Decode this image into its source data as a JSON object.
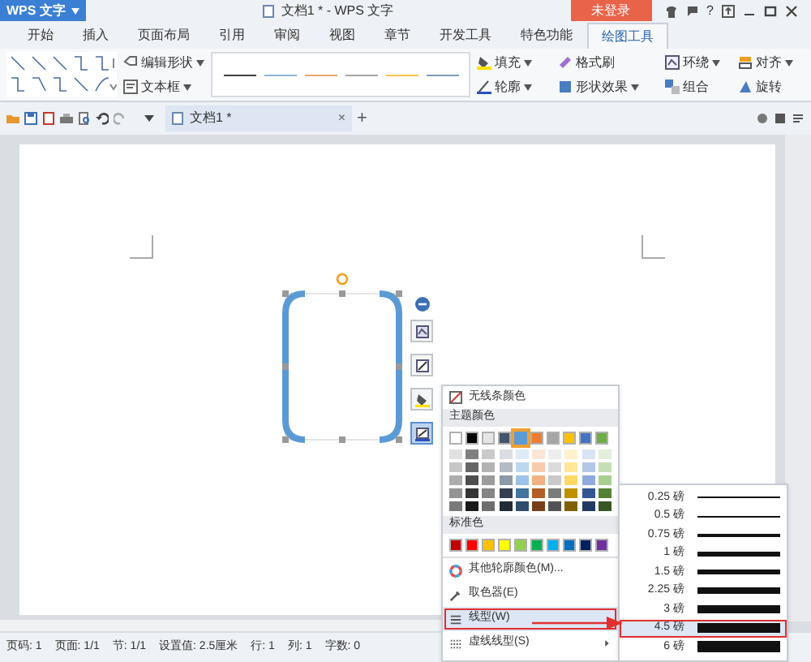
{
  "app_button": {
    "label": "WPS 文字"
  },
  "window": {
    "title": "文档1 * - WPS 文字"
  },
  "login_button": {
    "label": "未登录"
  },
  "help": {
    "label": "?"
  },
  "tabs": [
    {
      "label": "开始",
      "selected": false
    },
    {
      "label": "插入",
      "selected": false
    },
    {
      "label": "页面布局",
      "selected": false
    },
    {
      "label": "引用",
      "selected": false
    },
    {
      "label": "审阅",
      "selected": false
    },
    {
      "label": "视图",
      "selected": false
    },
    {
      "label": "章节",
      "selected": false
    },
    {
      "label": "开发工具",
      "selected": false
    },
    {
      "label": "特色功能",
      "selected": false
    },
    {
      "label": "绘图工具",
      "selected": true
    }
  ],
  "ribbon": {
    "shape_buttons": [
      {
        "label": "编辑形状"
      },
      {
        "label": "文本框"
      }
    ],
    "line_styles": [
      {
        "color": "#404040"
      },
      {
        "color": "#8fb4d9"
      },
      {
        "color": "#e8a86a"
      },
      {
        "color": "#a6a6a6"
      },
      {
        "color": "#f2c44a"
      },
      {
        "color": "#7f9bb8"
      }
    ],
    "format_buttons": [
      {
        "label": "填充",
        "dropdown": true
      },
      {
        "label": "格式刷",
        "dropdown": false
      },
      {
        "label": "轮廓",
        "dropdown": true
      },
      {
        "label": "形状效果",
        "dropdown": true
      }
    ],
    "arrange_buttons": [
      {
        "label": "环绕",
        "dropdown": true
      },
      {
        "label": "对齐",
        "dropdown": true
      },
      {
        "label": "组合",
        "dropdown": false
      },
      {
        "label": "旋转",
        "dropdown": false
      }
    ]
  },
  "doc_tab": {
    "title": "文档1 *",
    "close": "×"
  },
  "new_tab": {
    "label": "+"
  },
  "side_toolbar": [
    {
      "kind": "layout",
      "selected": false
    },
    {
      "kind": "edit",
      "selected": false
    },
    {
      "kind": "fill",
      "selected": false
    },
    {
      "kind": "outline",
      "selected": true
    }
  ],
  "color_menu": {
    "no_line": "无线条颜色",
    "theme_header": "主题颜色",
    "theme_colors": [
      {
        "color": "#ffffff",
        "selected": false
      },
      {
        "color": "#000000",
        "selected": false
      },
      {
        "color": "#e7e6e6",
        "selected": false
      },
      {
        "color": "#44546a",
        "selected": false
      },
      {
        "color": "#5b9bd5",
        "selected": true
      },
      {
        "color": "#ed7d31",
        "selected": false
      },
      {
        "color": "#a5a5a5",
        "selected": false
      },
      {
        "color": "#ffc000",
        "selected": false
      },
      {
        "color": "#4472c4",
        "selected": false
      },
      {
        "color": "#70ad47",
        "selected": false
      }
    ],
    "standard_header": "标准色",
    "standard_colors": [
      {
        "color": "#c00000"
      },
      {
        "color": "#ff0000"
      },
      {
        "color": "#ffc000"
      },
      {
        "color": "#ffff00"
      },
      {
        "color": "#92d050"
      },
      {
        "color": "#00b050"
      },
      {
        "color": "#00b0f0"
      },
      {
        "color": "#0070c0"
      },
      {
        "color": "#002060"
      },
      {
        "color": "#7030a0"
      }
    ],
    "items": [
      {
        "kind": "more-colors",
        "label": "其他轮廓颜色(M)...",
        "selected": false,
        "submenu_arrow": false
      },
      {
        "kind": "eyedropper",
        "label": "取色器(E)",
        "selected": false,
        "submenu_arrow": false
      },
      {
        "kind": "line-style",
        "label": "线型(W)",
        "selected": true,
        "submenu_arrow": false
      },
      {
        "kind": "dash-style",
        "label": "虚线线型(S)",
        "selected": false,
        "submenu_arrow": true
      }
    ]
  },
  "line_weights": [
    {
      "label": "0.25 磅",
      "selected": false
    },
    {
      "label": "0.5 磅",
      "selected": false
    },
    {
      "label": "0.75 磅",
      "selected": false
    },
    {
      "label": "1 磅",
      "selected": false
    },
    {
      "label": "1.5 磅",
      "selected": false
    },
    {
      "label": "2.25 磅",
      "selected": false
    },
    {
      "label": "3 磅",
      "selected": false
    },
    {
      "label": "4.5 磅",
      "selected": true
    },
    {
      "label": "6 磅",
      "selected": false
    }
  ],
  "status_bar": [
    "页码: 1",
    "页面: 1/1",
    "节: 1/1",
    "设置值: 2.5厘米",
    "行: 1",
    "列: 1",
    "字数: 0"
  ]
}
